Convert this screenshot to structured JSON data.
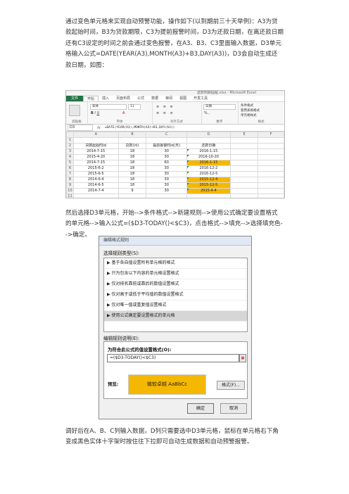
{
  "paragraphs": {
    "p1": "通过变色单元格来实现自动预警功能，操作如下(以到期前三十天举例)：A3为贷款起始时间，B3为贷款期限，C3为提前报警时间，D3为还款日期，在离还款日期还有C3设定的时间之前会通过变色报警，在A3、B3、C3里面输入数据，D3单元格输入公式=DATE(YEAR(A3),MONTH(A3)+B3,DAY(A3))，D3会自动生成还款日期，如图：",
    "p2": "然后选择D3单元格，开始-->条件格式-->新建规则-->使用公式确定要设置格式的单元格-->输入公式=($D3-TODAY()<$C3)，点击格式-->填充-->选择填充色-->确定。",
    "p3": "调好后在A、B、C列输入数据，D列只需要选中D3单元格，鼠标在单元格右下角变成黑色实体十字架时按住往下拉即可自动生成数据和自动预警报警。"
  },
  "excel": {
    "title": "送款到期提醒.xlsx - Microsoft Excel",
    "tabs": [
      "文件",
      "开始",
      "插入",
      "页面布局",
      "公式",
      "数据",
      "审阅",
      "视图",
      "开发工具"
    ],
    "ribbon": {
      "font_name": "宋体",
      "font_size": "11",
      "number_format": "日期",
      "cond_format": "条件格式",
      "table_format": "套用表格格式",
      "cell_style": "单元格样式",
      "groups": [
        "剪贴板",
        "字体",
        "对齐方式",
        "数字",
        "样式"
      ]
    },
    "name_box": "D3",
    "fx": "fx",
    "formula": "=DATE(YEAR(A3),MONTH(A3)+B3,DAY(A3))",
    "columns": [
      "A",
      "B",
      "C",
      "D",
      "E",
      "F"
    ],
    "row_numbers": [
      "1",
      "2",
      "3",
      "4",
      "5",
      "6",
      "7",
      "8",
      "9",
      "10",
      "11",
      "12",
      "13",
      "14"
    ],
    "headers": [
      "贷款起始时间",
      "贷款(月)",
      "提前报警时间(天)",
      "还款日期"
    ],
    "rows": [
      [
        "2014-7-15",
        "18",
        "30",
        "2016-1-15"
      ],
      [
        "2015-4-20",
        "18",
        "30",
        "2016-10-20"
      ],
      [
        "2014-7-15",
        "18",
        "60",
        "2016-1-15"
      ],
      [
        "2015-6-2",
        "18",
        "30",
        "2016-12-2"
      ],
      [
        "2015-6-5",
        "18",
        "30",
        "2016-12-5"
      ],
      [
        "2014-6-4",
        "18",
        "30",
        "2015-12-4"
      ],
      [
        "2014-6-5",
        "18",
        "30",
        "2015-12-5"
      ],
      [
        "2014-7-4",
        "9",
        "30",
        "2015-4-4"
      ]
    ],
    "highlight_rows": [
      2,
      5,
      6,
      7
    ],
    "highlight_color": "#f5b800"
  },
  "dialog": {
    "title": "编辑格式规则",
    "select_type_label": "选择规则类型(S):",
    "rules": [
      "▶ 基于各自值设置所有单元格的格式",
      "▶ 只为包含以下内容的单元格设置格式",
      "▶ 仅对排名靠前或靠后的数值设置格式",
      "▶ 仅对高于或低于平均值的数值设置格式",
      "▶ 仅对唯一值或重复值设置格式",
      "▶ 使用公式确定要设置格式的单元格"
    ],
    "selected_rule_index": 5,
    "edit_desc_label": "编辑规则说明(E):",
    "formula_title": "为符合此公式的值设置格式(O):",
    "formula_value": "=($D3-TODAY()<$C3)",
    "preview_label": "预览:",
    "preview_text": "微软卓越  AaBbCc",
    "preview_color": "#f5b800",
    "format_button": "格式(F)...",
    "ok_button": "确定",
    "cancel_button": "取消"
  }
}
